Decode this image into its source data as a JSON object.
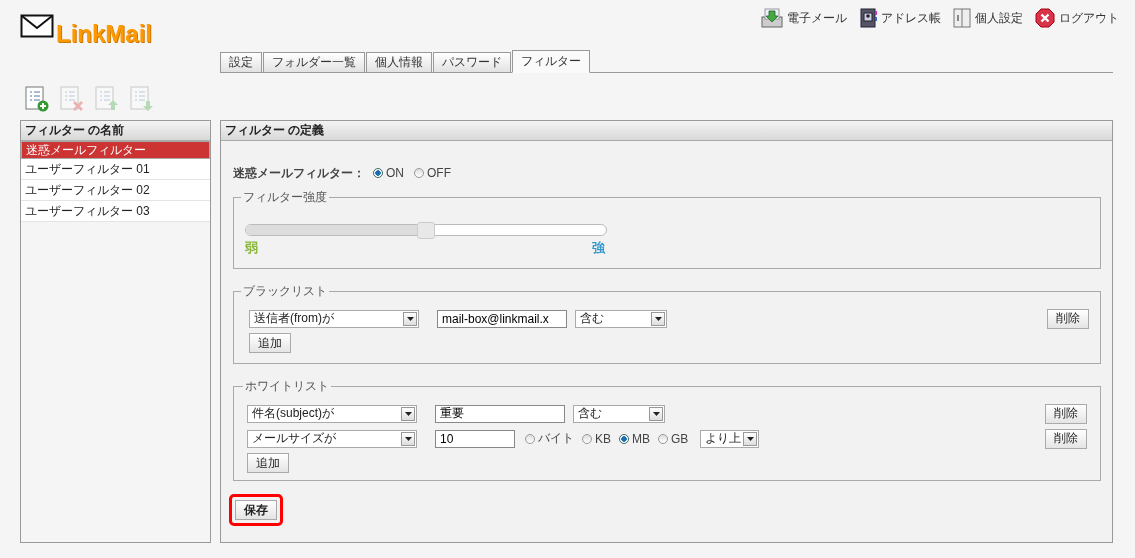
{
  "header": {
    "logo": "LinkMail",
    "nav": [
      {
        "kind": "mail",
        "label": "電子メール"
      },
      {
        "kind": "addressbook",
        "label": "アドレス帳"
      },
      {
        "kind": "settings",
        "label": "個人設定"
      },
      {
        "kind": "logout",
        "label": "ログアウト"
      }
    ]
  },
  "tabs": [
    {
      "label": "設定",
      "selected": false
    },
    {
      "label": "フォルダー一覧",
      "selected": false
    },
    {
      "label": "個人情報",
      "selected": false
    },
    {
      "label": "パスワード",
      "selected": false
    },
    {
      "label": "フィルター",
      "selected": true
    }
  ],
  "toolbar": [
    {
      "kind": "add",
      "disabled": false
    },
    {
      "kind": "delete",
      "disabled": true
    },
    {
      "kind": "up",
      "disabled": true
    },
    {
      "kind": "down",
      "disabled": true
    }
  ],
  "filter_list": {
    "title": "フィルター の名前",
    "items": [
      {
        "label": "迷惑メールフィルター",
        "selected": true
      },
      {
        "label": "ユーザーフィルター 01",
        "selected": false
      },
      {
        "label": "ユーザーフィルター 02",
        "selected": false
      },
      {
        "label": "ユーザーフィルター 03",
        "selected": false
      }
    ]
  },
  "definition": {
    "title": "フィルター の定義",
    "spam_filter": {
      "label": "迷惑メールフィルター：",
      "options": [
        {
          "label": "ON",
          "selected": true
        },
        {
          "label": "OFF",
          "selected": false
        }
      ]
    },
    "strength": {
      "legend": "フィルター強度",
      "level": 0.5,
      "low_label": "弱",
      "high_label": "強"
    },
    "blacklist": {
      "legend": "ブラックリスト",
      "rules": [
        {
          "kind": "text",
          "field": "送信者(from)が",
          "value": "mail-box@linkmail.x",
          "condition": "含む",
          "delete_label": "削除"
        }
      ],
      "add_label": "追加"
    },
    "whitelist": {
      "legend": "ホワイトリスト",
      "rules": [
        {
          "kind": "text",
          "field": "件名(subject)が",
          "value": "重要",
          "condition": "含む",
          "delete_label": "削除"
        },
        {
          "kind": "size",
          "field": "メールサイズが",
          "value": "10",
          "units": [
            {
              "label": "バイト",
              "selected": false
            },
            {
              "label": "KB",
              "selected": false
            },
            {
              "label": "MB",
              "selected": true
            },
            {
              "label": "GB",
              "selected": false
            }
          ],
          "condition": "より上",
          "delete_label": "削除"
        }
      ],
      "add_label": "追加"
    },
    "save": {
      "label": "保存",
      "highlighted": true
    }
  }
}
